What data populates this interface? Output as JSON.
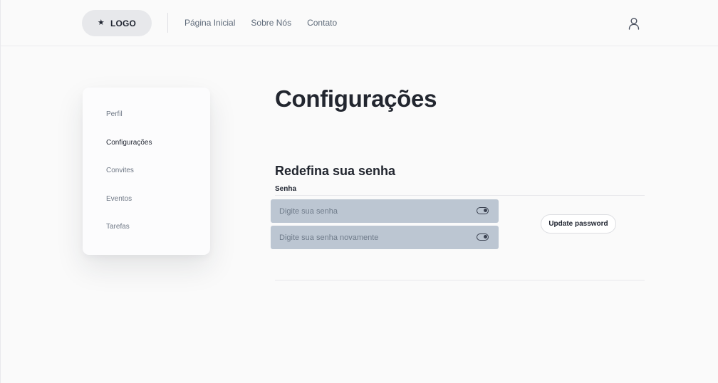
{
  "header": {
    "logo_icon": "star-icon",
    "logo_star": "★",
    "logo_label": "LOGO",
    "nav": [
      {
        "label": "Página Inicial"
      },
      {
        "label": "Sobre Nós"
      },
      {
        "label": "Contato"
      }
    ],
    "user_icon": "user-icon"
  },
  "sidebar": {
    "items": [
      {
        "label": "Perfil",
        "active": false
      },
      {
        "label": "Configurações",
        "active": true
      },
      {
        "label": "Convites",
        "active": false
      },
      {
        "label": "Eventos",
        "active": false
      },
      {
        "label": "Tarefas",
        "active": false
      }
    ]
  },
  "main": {
    "title": "Configurações",
    "section_title": "Redefina sua senha",
    "field_label": "Senha",
    "password": {
      "value": "",
      "placeholder": "Digite sua senha",
      "toggle_icon": "toggle-visibility-icon"
    },
    "password_confirm": {
      "value": "",
      "placeholder": "Digite sua senha novamente",
      "toggle_icon": "toggle-visibility-icon"
    },
    "update_button": "Update password"
  },
  "colors": {
    "background": "#fafafa",
    "input_fill": "#bcc6d2",
    "text_primary": "#1f2430",
    "text_muted": "#6e7785"
  }
}
